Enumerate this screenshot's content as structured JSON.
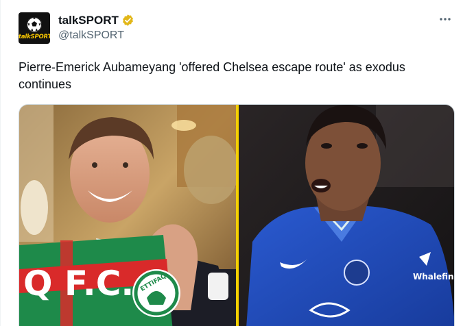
{
  "account": {
    "display_name": "talkSPORT",
    "handle": "@talkSPORT",
    "avatar_text": "talkSPORT",
    "verified_color": "#e2b719"
  },
  "tweet": {
    "text": "Pierre-Emerick Aubameyang 'offered Chelsea escape route' as exodus continues"
  },
  "media": {
    "left_scarf_text": "Q F.C.",
    "left_badge_text": "ETTIFAQ",
    "right_sponsor_text": "Whalefin",
    "divider_color": "#f5d000"
  },
  "colors": {
    "text_primary": "#0f1419",
    "text_secondary": "#536471",
    "chelsea_blue": "#1f4fc2",
    "scarf_green": "#1e8a4a",
    "scarf_red": "#d92a2a"
  },
  "icons": {
    "more": "more-dots-icon",
    "verified": "verified-badge-icon"
  }
}
